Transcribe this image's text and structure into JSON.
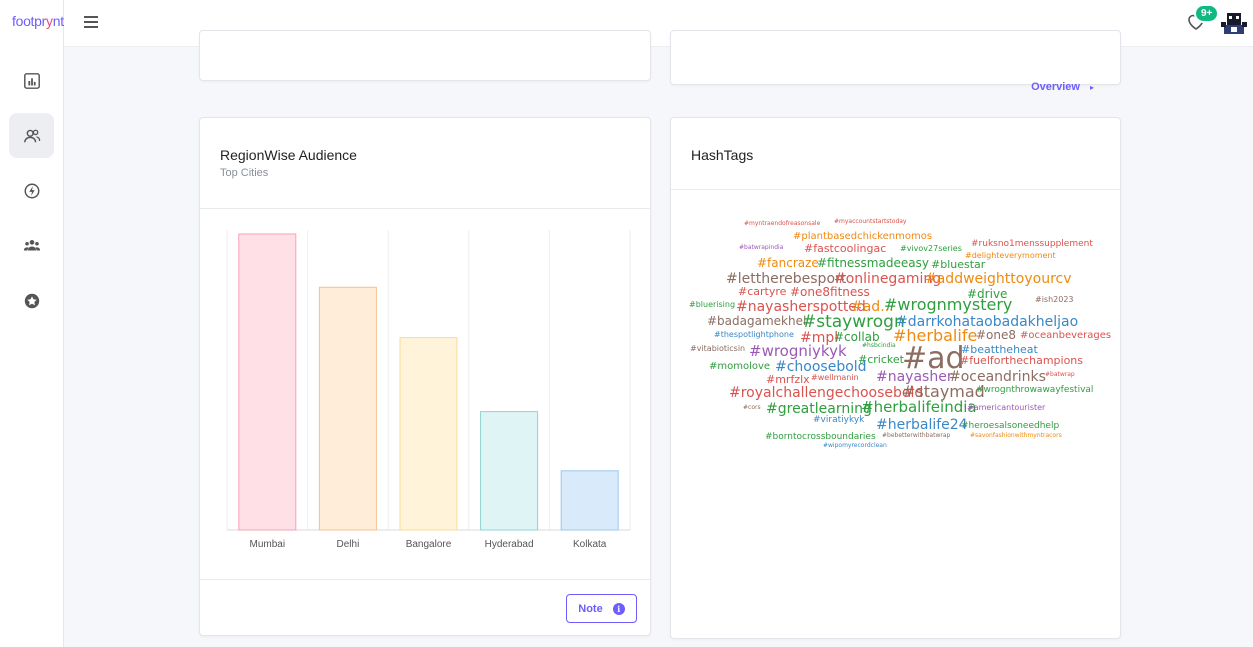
{
  "app": {
    "logo_main": "footpr",
    "logo_y": "y",
    "logo_tail": "nt"
  },
  "sidebar": {
    "items": [
      {
        "name": "analytics",
        "icon": "bar-chart-icon"
      },
      {
        "name": "audience",
        "icon": "users-icon",
        "active": true
      },
      {
        "name": "quick",
        "icon": "lightning-icon"
      },
      {
        "name": "groups",
        "icon": "group-icon"
      },
      {
        "name": "favorites",
        "icon": "star-icon"
      }
    ]
  },
  "header": {
    "notification_count": "9+"
  },
  "top_card": {
    "overview_label": "Overview",
    "overview_arrow": "▸"
  },
  "region_card": {
    "title": "RegionWise Audience",
    "subtitle": "Top Cities",
    "note_label": "Note",
    "note_icon": "i"
  },
  "chart_data": {
    "type": "bar",
    "categories": [
      "Mumbai",
      "Delhi",
      "Bangalore",
      "Hyderabad",
      "Kolkata"
    ],
    "values": [
      100,
      82,
      65,
      40,
      20
    ],
    "ylim": [
      0,
      100
    ],
    "grid": true,
    "colors": {
      "fill": [
        "#ffe0e6",
        "#ffecd9",
        "#fff4d9",
        "#dff4f4",
        "#d9eafa"
      ],
      "stroke": [
        "#f4a3b6",
        "#f7c08e",
        "#f7dc93",
        "#8fd3d3",
        "#9cc8ee"
      ]
    }
  },
  "hashtags_card": {
    "title": "HashTags",
    "tags": [
      {
        "text": "#myntraendofreasonsale",
        "color": "#d9534f",
        "size": 6
      },
      {
        "text": "#myaccountstartstoday",
        "color": "#d9534f",
        "size": 6
      },
      {
        "text": "#plantbasedchickenmomos",
        "color": "#f0890f",
        "size": 10
      },
      {
        "text": "#ruksno1menssupplement",
        "color": "#d9534f",
        "size": 9
      },
      {
        "text": "#batwrapindia",
        "color": "#9b59b6",
        "size": 6
      },
      {
        "text": "#fastcoolingac",
        "color": "#d9534f",
        "size": 11
      },
      {
        "text": "#vivov27series",
        "color": "#2e9e3e",
        "size": 8
      },
      {
        "text": "#delighteverymoment",
        "color": "#f0890f",
        "size": 8
      },
      {
        "text": "#fancraze",
        "color": "#f0890f",
        "size": 12
      },
      {
        "text": "#fitnessmadeeasy",
        "color": "#2e9e3e",
        "size": 12
      },
      {
        "text": "#bluestar",
        "color": "#2e9e3e",
        "size": 11
      },
      {
        "text": "#lettherebesport",
        "color": "#8c6d62",
        "size": 14
      },
      {
        "text": "#onlinegaming",
        "color": "#d9534f",
        "size": 14
      },
      {
        "text": "#addweighttoyourcv",
        "color": "#f0890f",
        "size": 14
      },
      {
        "text": "#cartyre",
        "color": "#d9534f",
        "size": 11
      },
      {
        "text": "#one8fitness",
        "color": "#d9534f",
        "size": 12
      },
      {
        "text": "#drive",
        "color": "#2e9e3e",
        "size": 12
      },
      {
        "text": "#ish2023",
        "color": "#8c6d62",
        "size": 8
      },
      {
        "text": "#bluerising",
        "color": "#2e9e3e",
        "size": 8
      },
      {
        "text": "#nayasherspotted",
        "color": "#d9534f",
        "size": 14
      },
      {
        "text": "#ad...",
        "color": "#f0890f",
        "size": 14
      },
      {
        "text": "#wrognmystery",
        "color": "#2e9e3e",
        "size": 16
      },
      {
        "text": "#badagamekhel",
        "color": "#8c6d62",
        "size": 12
      },
      {
        "text": "#staywrogn",
        "color": "#2e9e3e",
        "size": 17
      },
      {
        "text": "#darrkohataobadakheljao",
        "color": "#3a87c8",
        "size": 14
      },
      {
        "text": "#thespotlightphone",
        "color": "#3a87c8",
        "size": 8
      },
      {
        "text": "#mpl",
        "color": "#d9534f",
        "size": 14
      },
      {
        "text": "#collab",
        "color": "#2e9e3e",
        "size": 12
      },
      {
        "text": "#herbalife",
        "color": "#f0890f",
        "size": 16
      },
      {
        "text": "#one8",
        "color": "#8c6d62",
        "size": 12
      },
      {
        "text": "#oceanbeverages",
        "color": "#d9534f",
        "size": 10
      },
      {
        "text": "#vitabioticsin",
        "color": "#8c6d62",
        "size": 8
      },
      {
        "text": "#wrogniykyk",
        "color": "#9b59b6",
        "size": 15
      },
      {
        "text": "#hsbcindia",
        "color": "#2e9e3e",
        "size": 6
      },
      {
        "text": "#beattheheat",
        "color": "#3a87c8",
        "size": 11
      },
      {
        "text": "#cricket",
        "color": "#2e9e3e",
        "size": 11
      },
      {
        "text": "#ad",
        "color": "#8c6d62",
        "size": 30
      },
      {
        "text": "#fuelforthechampions",
        "color": "#d9534f",
        "size": 11
      },
      {
        "text": "#momolove",
        "color": "#2e9e3e",
        "size": 10
      },
      {
        "text": "#choosebold",
        "color": "#3a87c8",
        "size": 14
      },
      {
        "text": "#nayasher",
        "color": "#9b59b6",
        "size": 14
      },
      {
        "text": "#oceandrinks",
        "color": "#8c6d62",
        "size": 14
      },
      {
        "text": "#mrfzlx",
        "color": "#d9534f",
        "size": 11
      },
      {
        "text": "#wellmanin",
        "color": "#d9534f",
        "size": 8
      },
      {
        "text": "#batwrap",
        "color": "#d9534f",
        "size": 6
      },
      {
        "text": "#royalchallengechoosebold",
        "color": "#d9534f",
        "size": 14
      },
      {
        "text": "#staymad",
        "color": "#8c6d62",
        "size": 16
      },
      {
        "text": "#wrognthrowawayfestival",
        "color": "#2e9e3e",
        "size": 9
      },
      {
        "text": "#cors",
        "color": "#8c6d62",
        "size": 6
      },
      {
        "text": "#greatlearning",
        "color": "#2e9e3e",
        "size": 14
      },
      {
        "text": "#herbalifeindia",
        "color": "#2e9e3e",
        "size": 15
      },
      {
        "text": "#americantourister",
        "color": "#9b59b6",
        "size": 8
      },
      {
        "text": "#viratiykyk",
        "color": "#3a87c8",
        "size": 9
      },
      {
        "text": "#herbalife24",
        "color": "#3a87c8",
        "size": 14
      },
      {
        "text": "#heroesalsoneedhelp",
        "color": "#2e9e3e",
        "size": 9
      },
      {
        "text": "#borntocrossboundaries",
        "color": "#2e9e3e",
        "size": 9
      },
      {
        "text": "#bebetterwithbatwrap",
        "color": "#8c6d62",
        "size": 6
      },
      {
        "text": "#savonfashionwithmyntracors",
        "color": "#f0890f",
        "size": 6
      },
      {
        "text": "#wipomyrecordclean",
        "color": "#3a87c8",
        "size": 6
      }
    ]
  }
}
